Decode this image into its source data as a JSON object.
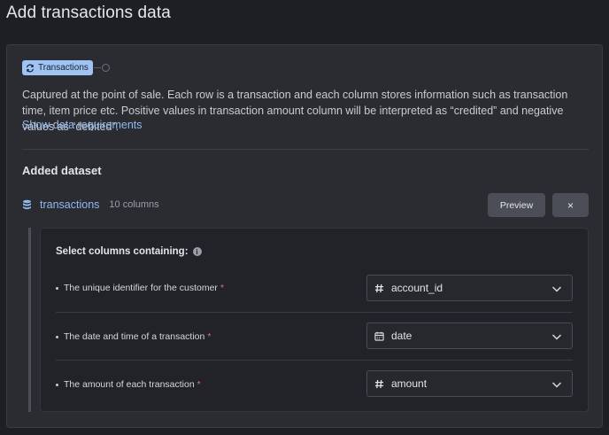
{
  "page": {
    "title": "Add transactions data"
  },
  "dataset_type": {
    "badge_label": "Transactions",
    "description": "Captured at the point of sale. Each row is a transaction and each column stores information such as transaction time, item price etc. Positive values in transaction amount column will be interpreted as “credited” and negative values as “debited”.",
    "requirements_link": "Show data requirements"
  },
  "added_dataset": {
    "section_title": "Added dataset",
    "name": "transactions",
    "column_count": "10 columns",
    "preview_label": "Preview",
    "remove_label": "×"
  },
  "column_mapping": {
    "title": "Select columns containing:",
    "rows": [
      {
        "label": "The unique identifier for the customer",
        "required_mark": "*",
        "value": "account_id",
        "icon": "hash-icon"
      },
      {
        "label": "The date and time of a transaction",
        "required_mark": "*",
        "value": "date",
        "icon": "calendar-icon"
      },
      {
        "label": "The amount of each transaction",
        "required_mark": "*",
        "value": "amount",
        "icon": "hash-icon"
      }
    ]
  },
  "colors": {
    "accent": "#9fc3f2",
    "link": "#8fbaf0",
    "required": "#e86e6e",
    "background": "#1e1f23",
    "card": "#2b2c32"
  }
}
